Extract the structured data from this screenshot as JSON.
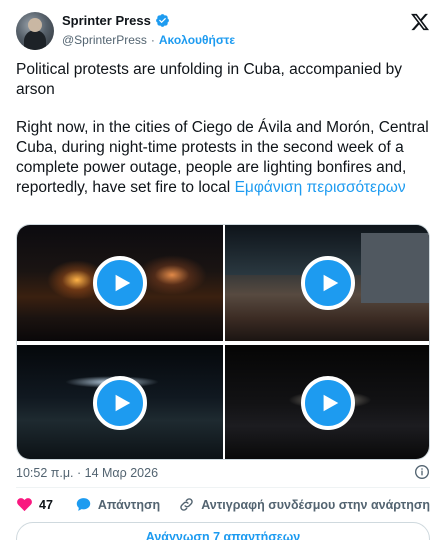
{
  "author": {
    "name": "Sprinter Press",
    "handle": "@SprinterPress",
    "separator": "·",
    "follow_label": "Ακολουθήστε"
  },
  "tweet": {
    "paragraph1": "Political protests are unfolding in Cuba, accompanied by arson",
    "paragraph2": "Right now, in the cities of Ciego de Ávila and Morón, Central Cuba, during night-time protests in the second week of a complete power outage, people are lighting bonfires and, reportedly, have set fire to local",
    "show_more": "Εμφάνιση περισσότερων"
  },
  "media": {
    "count": 4,
    "type": "video",
    "play_icon": "play-icon"
  },
  "meta": {
    "timestamp": "10:52 π.μ. · 14 Μαρ 2026",
    "info_icon": "info-icon"
  },
  "actions": {
    "like_count": "47",
    "reply_label": "Απάντηση",
    "copy_link_label": "Αντιγραφή συνδέσμου στην ανάρτηση"
  },
  "read_replies_label": "Ανάγνωση 7 απαντήσεων",
  "colors": {
    "accent": "#1d9bf0",
    "like": "#f91880",
    "text": "#0f1419",
    "secondary": "#536471"
  }
}
